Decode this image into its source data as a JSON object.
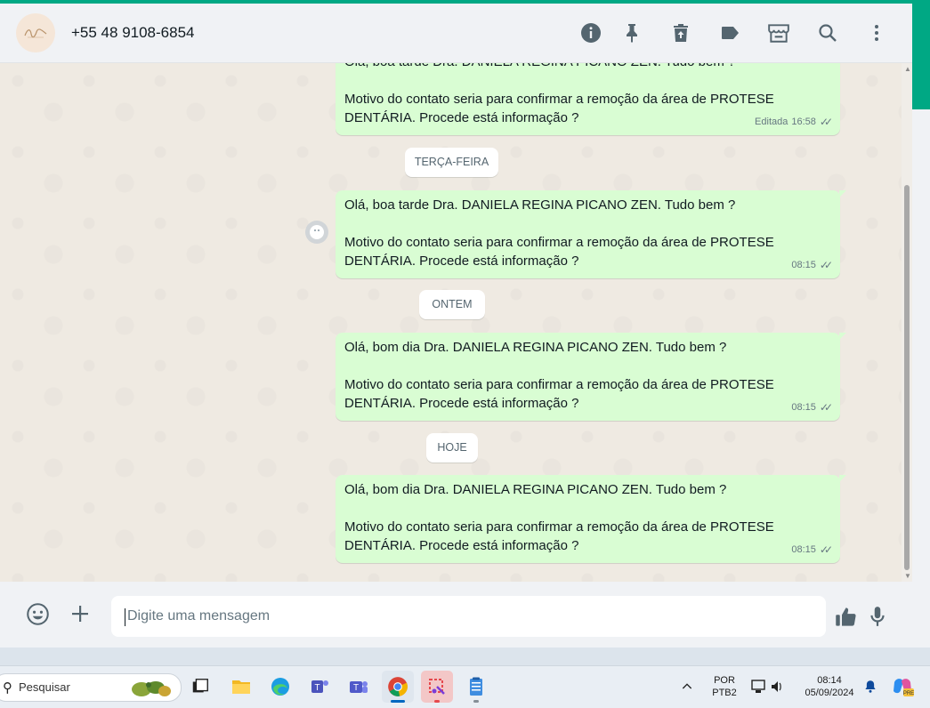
{
  "header": {
    "contact_name": "+55 48 9108-6854",
    "icons": [
      "info-icon",
      "pin-icon",
      "delete-icon",
      "label-icon",
      "store-icon",
      "search-icon",
      "more-menu-icon"
    ]
  },
  "messages": [
    {
      "line1": "Olá, boa tarde Dra.  DANIELA REGINA PICANO ZEN. Tudo bem ?",
      "line2": "Motivo do contato seria para confirmar a remoção da área de PROTESE",
      "line3": "DENTÁRIA. Procede está informação ?",
      "edited": "Editada",
      "time": "16:58",
      "ticks": "✓✓"
    },
    {
      "line1": "Olá, boa tarde Dra.  DANIELA REGINA PICANO ZEN. Tudo bem ?",
      "line2": "Motivo do contato seria para confirmar a remoção da área de PROTESE",
      "line3": "DENTÁRIA. Procede está informação ?",
      "time": "08:15",
      "ticks": "✓✓"
    },
    {
      "line1": "Olá, bom dia Dra.  DANIELA REGINA PICANO ZEN. Tudo bem ?",
      "line2": "Motivo do contato seria para confirmar a remoção da área de PROTESE",
      "line3": "DENTÁRIA. Procede está informação ?",
      "time": "08:15",
      "ticks": "✓✓"
    },
    {
      "line1": "Olá, bom dia Dra.  DANIELA REGINA PICANO ZEN. Tudo bem ?",
      "line2": "Motivo do contato seria para confirmar a remoção da área de PROTESE",
      "line3": "DENTÁRIA. Procede está informação ?",
      "time": "08:15",
      "ticks": "✓✓"
    }
  ],
  "date_separators": [
    "TERÇA-FEIRA",
    "ONTEM",
    "HOJE"
  ],
  "composer": {
    "placeholder": "Digite uma mensagem"
  },
  "taskbar": {
    "search_label": "Pesquisar",
    "lang_top": "POR",
    "lang_bottom": "PTB2",
    "time": "08:14",
    "date": "05/09/2024",
    "copilot_badge": "PRE"
  },
  "colors": {
    "accent": "#00a884",
    "outgoing_bubble": "#d9fdd3",
    "chat_bg": "#efeae2",
    "header_bg": "#f0f2f5"
  }
}
